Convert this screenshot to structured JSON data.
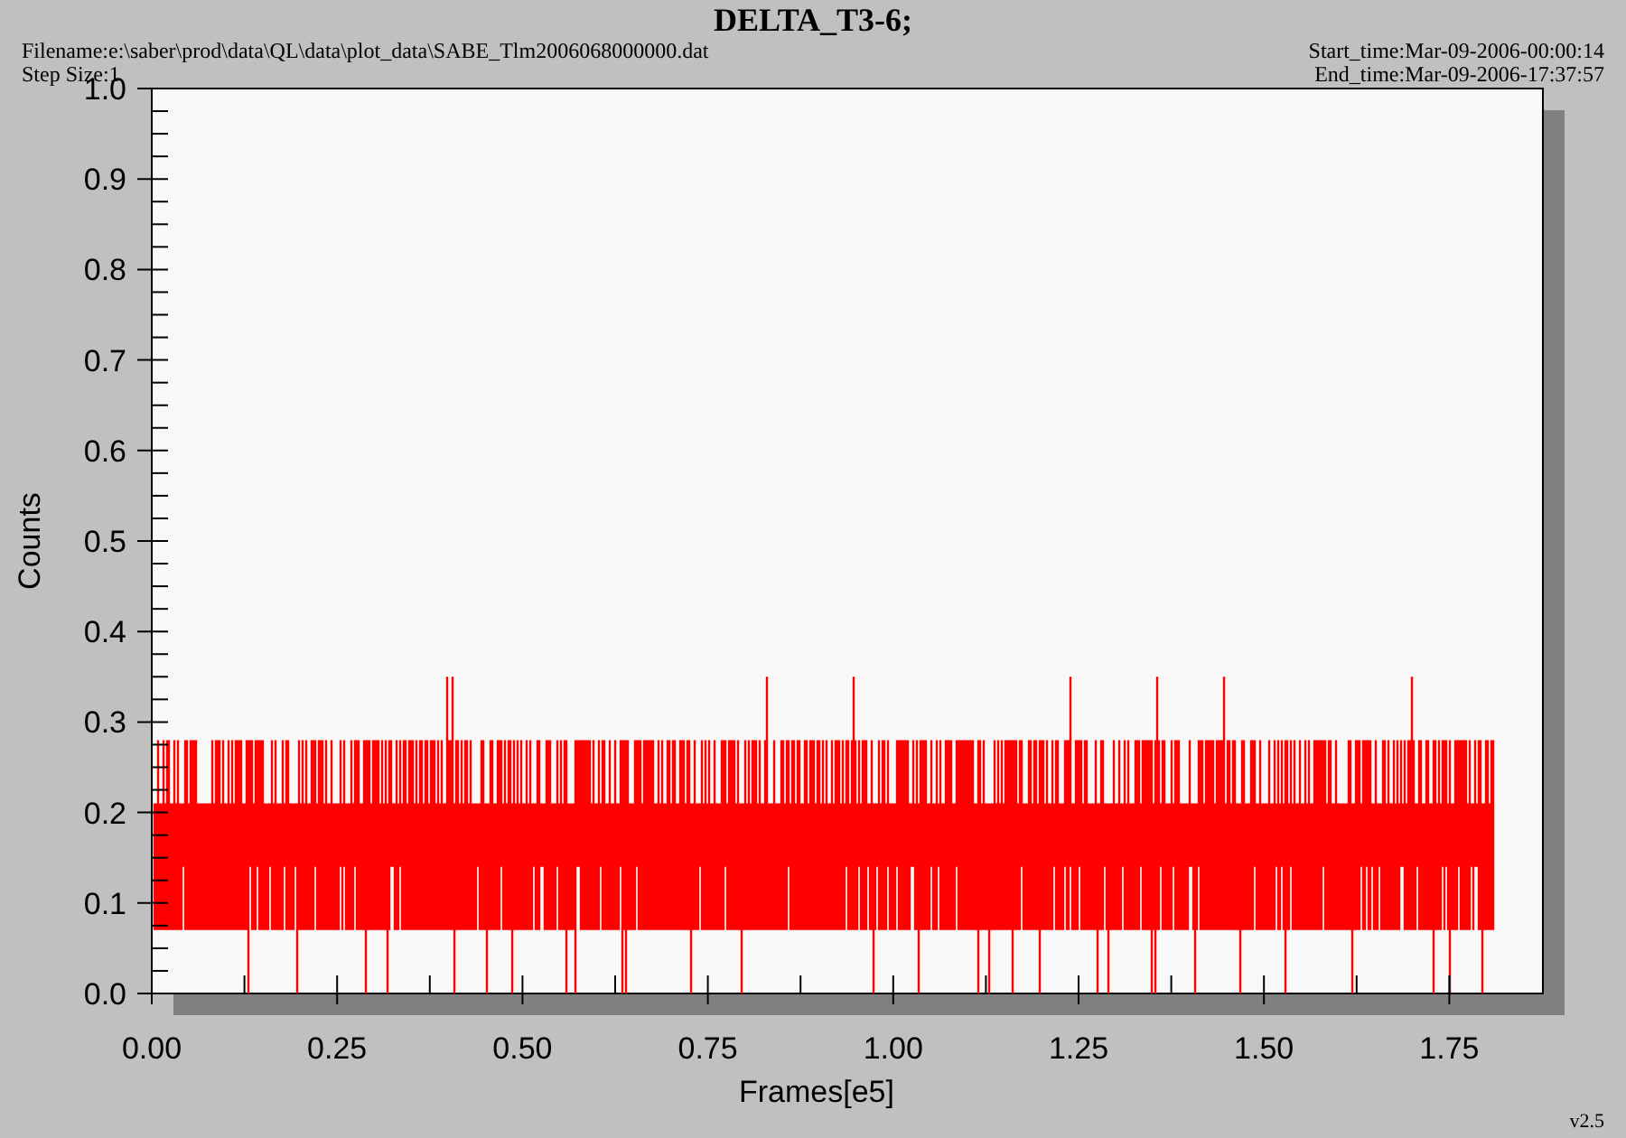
{
  "title": "DELTA_T3-6;",
  "header": {
    "filename": "Filename:e:\\saber\\prod\\data\\QL\\data\\plot_data\\SABE_Tlm2006068000000.dat",
    "step_size": "Step Size:1",
    "start_time": "Start_time:Mar-09-2006-00:00:14",
    "end_time": "End_time:Mar-09-2006-17:37:57"
  },
  "y_axis": {
    "label": "Counts",
    "ticks": [
      "1.0",
      "0.9",
      "0.8",
      "0.7",
      "0.6",
      "0.5",
      "0.4",
      "0.3",
      "0.2",
      "0.1",
      "0.0"
    ]
  },
  "x_axis": {
    "label": "Frames[e5]",
    "ticks": [
      "0.00",
      "0.25",
      "0.50",
      "0.75",
      "1.00",
      "1.25",
      "1.50",
      "1.75"
    ]
  },
  "version": "v2.5"
}
